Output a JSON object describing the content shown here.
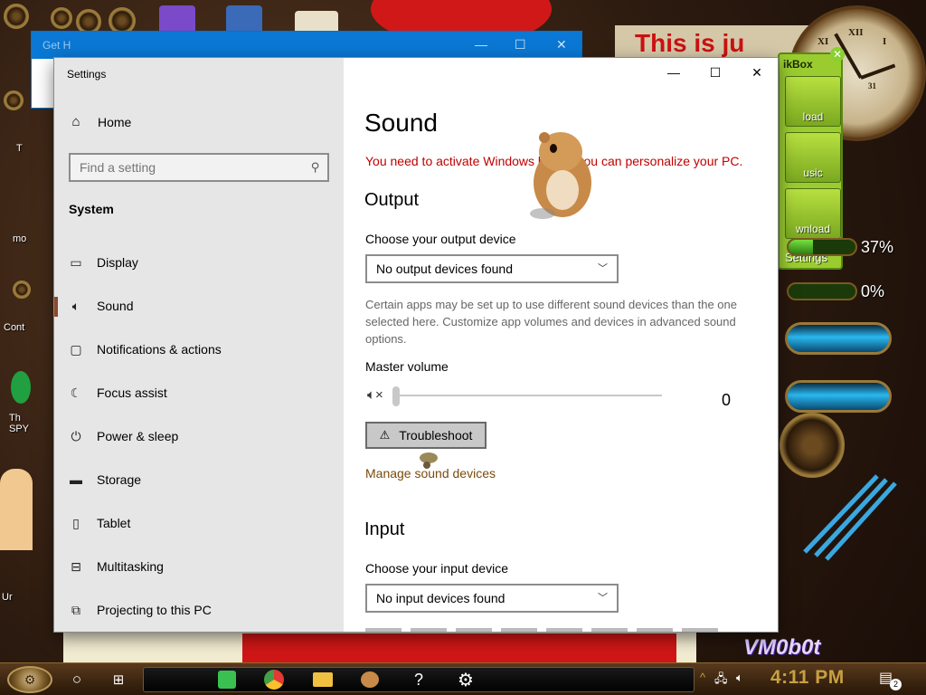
{
  "desktop": {
    "banner_text": "This is ju",
    "watermark": "VM0b0t",
    "widget": {
      "title": "ikBox",
      "buttons": [
        "load",
        "usic",
        "wnload"
      ],
      "settings_label": "Settings",
      "meter1_label": "37%",
      "meter1_value": 37,
      "meter2_label": "0%",
      "meter2_value": 0
    },
    "clock_numerals": [
      "XII",
      "I",
      "XI",
      "31"
    ],
    "icon_labels": [
      "T",
      "mo",
      "Cont",
      "Th SPY",
      "Ur"
    ]
  },
  "bg_window": {
    "title": "Get H"
  },
  "settings": {
    "app_title": "Settings",
    "window_controls": {
      "minimize": "—",
      "maximize": "☐",
      "close": "✕"
    },
    "nav": {
      "home": "Home",
      "search_placeholder": "Find a setting",
      "section": "System",
      "items": [
        {
          "label": "Display",
          "icon": "display-icon"
        },
        {
          "label": "Sound",
          "icon": "speaker-icon",
          "active": true
        },
        {
          "label": "Notifications & actions",
          "icon": "notification-icon"
        },
        {
          "label": "Focus assist",
          "icon": "moon-icon"
        },
        {
          "label": "Power & sleep",
          "icon": "power-icon"
        },
        {
          "label": "Storage",
          "icon": "storage-icon"
        },
        {
          "label": "Tablet",
          "icon": "tablet-icon"
        },
        {
          "label": "Multitasking",
          "icon": "multitasking-icon"
        },
        {
          "label": "Projecting to this PC",
          "icon": "projector-icon"
        }
      ]
    },
    "main": {
      "title": "Sound",
      "activation_warning": "You need to activate Windows before you can personalize your PC.",
      "output_heading": "Output",
      "output_device_label": "Choose your output device",
      "output_device_value": "No output devices found",
      "output_description": "Certain apps may be set up to use different sound devices than the one selected here. Customize app volumes and devices in advanced sound options.",
      "master_volume_label": "Master volume",
      "master_volume_value": "0",
      "troubleshoot_label": "Troubleshoot",
      "manage_link": "Manage sound devices",
      "input_heading": "Input",
      "input_device_label": "Choose your input device",
      "input_device_value": "No input devices found"
    }
  },
  "taskbar": {
    "time": "4:11 PM",
    "notification_count": "2"
  }
}
